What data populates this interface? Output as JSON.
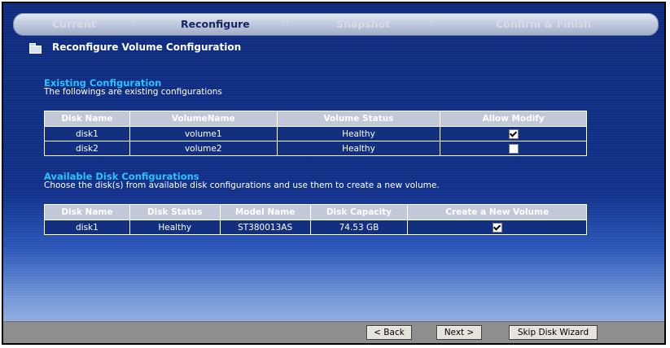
{
  "wizard_steps": [
    {
      "label": "Current",
      "active": false
    },
    {
      "label": "Reconfigure",
      "active": true
    },
    {
      "label": "Snapshot",
      "active": false
    },
    {
      "label": "Confirm & Finish",
      "active": false
    }
  ],
  "step_separators": [
    "›",
    "››",
    "›"
  ],
  "page_title": "Reconfigure Volume Configuration",
  "existing": {
    "title": "Existing Configuration",
    "description": "The followings are existing configurations",
    "columns": [
      "Disk Name",
      "VolumeName",
      "Volume Status",
      "Allow Modify"
    ],
    "rows": [
      {
        "disk": "disk1",
        "volume": "volume1",
        "status": "Healthy",
        "allow_modify": true
      },
      {
        "disk": "disk2",
        "volume": "volume2",
        "status": "Healthy",
        "allow_modify": false
      }
    ]
  },
  "available": {
    "title": "Available Disk Configurations",
    "description": "Choose the disk(s) from available disk configurations and use them to create a new volume.",
    "columns": [
      "Disk Name",
      "Disk Status",
      "Model Name",
      "Disk Capacity",
      "Create a New Volume"
    ],
    "rows": [
      {
        "disk": "disk1",
        "status": "Healthy",
        "model": "ST380013AS",
        "capacity": "74.53 GB",
        "create_new": true
      }
    ]
  },
  "buttons": {
    "back": "< Back",
    "next": "Next >",
    "skip": "Skip Disk Wizard"
  },
  "colors": {
    "accent_heading": "#29c2ff",
    "table_header": "#c1c8d8",
    "background_top": "#0d2a7d",
    "footer": "#8e8e8e"
  }
}
